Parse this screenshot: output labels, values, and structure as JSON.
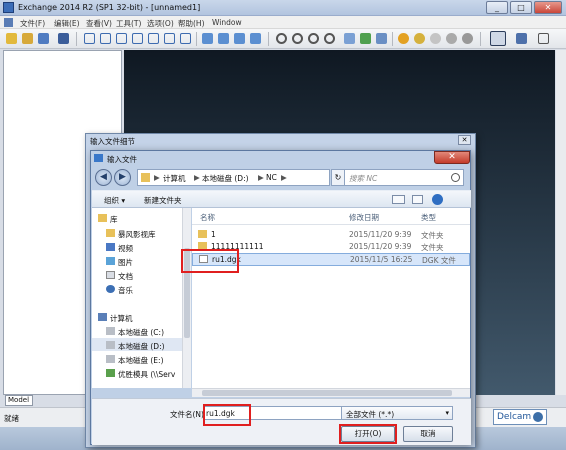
{
  "app": {
    "title": "Exchange 2014 R2 (SP1 32-bit) - [unnamed1]",
    "window_controls": [
      "_",
      "□",
      "✕"
    ]
  },
  "menu": [
    "文件(F)",
    "编辑(E)",
    "查看(V)",
    "工具(T)",
    "选项(O)",
    "帮助(H)",
    "Window"
  ],
  "left_panel": {
    "tab": "Model"
  },
  "status": {
    "text": "就绪",
    "brand": "Delcam"
  },
  "outer_dialog": {
    "title": "输入文件细节",
    "close": "✕"
  },
  "dialog": {
    "title": "输入文件",
    "close": "✕",
    "nav_back": "◀",
    "nav_forward": "▶",
    "address": [
      "计算机",
      "本地磁盘 (D:)",
      "NC"
    ],
    "address_sep": "▶",
    "refresh": "↻",
    "search_placeholder": "搜索 NC",
    "toolbar": {
      "organize": "组织 ▾",
      "new_folder": "新建文件夹"
    },
    "nav": {
      "libraries": "库",
      "lib_items": [
        "暴风影视库",
        "视频",
        "图片",
        "文档",
        "音乐"
      ],
      "computer": "计算机",
      "drives": [
        "本地磁盘 (C:)",
        "本地磁盘 (D:)",
        "本地磁盘 (E:)",
        "优胜模具 (\\\\Serv"
      ]
    },
    "columns": [
      "名称",
      "修改日期",
      "类型"
    ],
    "files": [
      {
        "name": "1",
        "date": "2015/11/20 9:39",
        "type": "文件夹"
      },
      {
        "name": "11111111111",
        "date": "2015/11/20 9:39",
        "type": "文件夹"
      },
      {
        "name": "ru1.dgk",
        "date": "2015/11/5 16:25",
        "type": "DGK 文件"
      }
    ],
    "filename_label": "文件名(N):",
    "filename_value": "ru1.dgk",
    "filetype_value": "全部文件 (*.*)",
    "open_button": "打开(O)",
    "cancel_button": "取消"
  },
  "colors": {
    "viewport_top": "#0f1822",
    "viewport_bottom": "#42596c",
    "highlight_red": "#e01f1f",
    "selection": "#d7e6fa"
  }
}
